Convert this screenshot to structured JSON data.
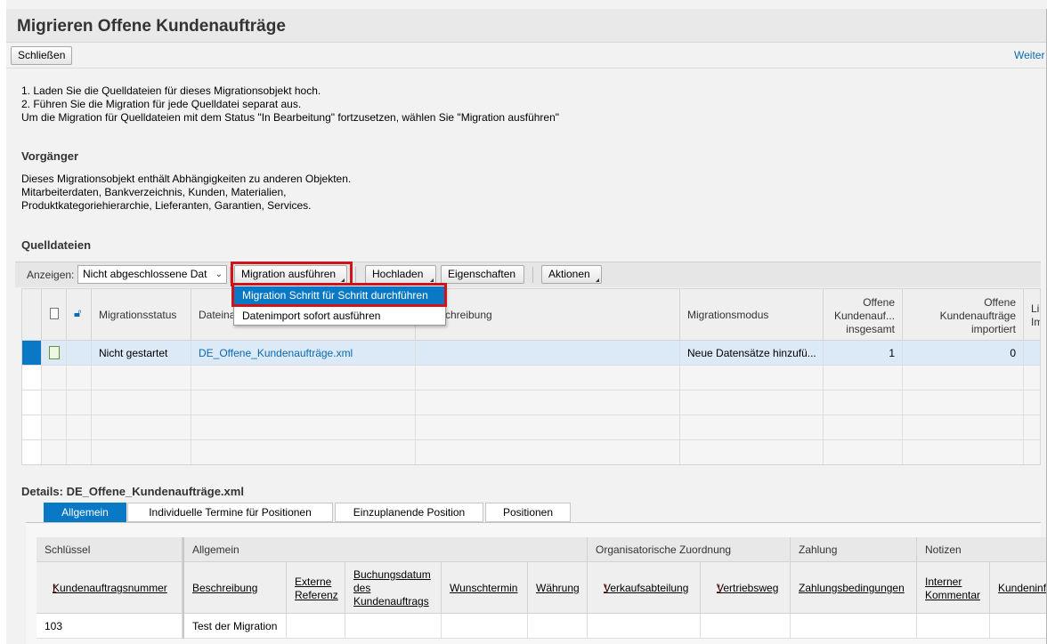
{
  "app": {
    "title": "Migrieren Offene Kundenaufträge",
    "close_label": "Schließen",
    "more_label": "Weiter"
  },
  "intro": {
    "line1": "1. Laden Sie die Quelldateien für dieses Migrationsobjekt hoch.",
    "line2": "2. Führen Sie die Migration für jede Quelldatei separat aus.",
    "line3": "Um die Migration für Quelldateien mit dem Status \"In Bearbeitung\" fortzusetzen, wählen Sie \"Migration ausführen\""
  },
  "predecessors": {
    "heading": "Vorgänger",
    "line1": "Dieses Migrationsobjekt enthält Abhängigkeiten zu anderen Objekten.",
    "line2": "Mitarbeiterdaten, Bankverzeichnis, Kunden, Materialien,",
    "line3": "Produktkategoriehierarchie, Lieferanten, Garantien, Services."
  },
  "source_files": {
    "heading": "Quelldateien",
    "show_label": "Anzeigen:",
    "filter_value": "Nicht abgeschlossene Dat",
    "run_migration": "Migration ausführen",
    "upload": "Hochladen",
    "properties": "Eigenschaften",
    "actions": "Aktionen",
    "menu": {
      "step_by_step": "Migration Schritt für Schritt durchführen",
      "import_now": "Datenimport sofort ausführen"
    },
    "columns": {
      "status": "Migrationsstatus",
      "file_name": "Dateina",
      "description": "schreibung",
      "mode": "Migrationsmodus",
      "total_l1": "Offene",
      "total_l2": "Kundenauf...",
      "total_l3": "insgesamt",
      "imported_l1": "Offene",
      "imported_l2": "Kundenaufträge",
      "imported_l3": "importiert",
      "more_l1": "Lin",
      "more_l2": "Imp"
    },
    "rows": [
      {
        "status": "Nicht gestartet",
        "file_name": "DE_Offene_Kundenaufträge.xml",
        "mode": "Neue Datensätze hinzufü...",
        "total": "1",
        "imported": "0"
      }
    ]
  },
  "details": {
    "heading": "Details: DE_Offene_Kundenaufträge.xml",
    "tabs": [
      "Allgemein",
      "Individuelle Termine für Positionen",
      "Einzuplanende Position",
      "Positionen"
    ],
    "groups": {
      "key": "Schlüssel",
      "general": "Allgemein",
      "org": "Organisatorische Zuordnung",
      "payment": "Zahlung",
      "notes": "Notizen"
    },
    "columns": {
      "order_number": "Kundenauftragsnummer",
      "description": "Beschreibung",
      "ext_ref_l1": "Externe",
      "ext_ref_l2": "Referenz",
      "booking_l1": "Buchungsdatum",
      "booking_l2": "des",
      "booking_l3": "Kundenauftrags",
      "wish_date": "Wunschtermin",
      "currency": "Währung",
      "sales_dept": "Verkaufsabteilung",
      "sales_channel": "Vertriebsweg",
      "payment_terms": "Zahlungsbedingungen",
      "internal_l1": "Interner",
      "internal_l2": "Kommentar",
      "customer_info": "Kundeninf"
    },
    "required_mark": "*",
    "rows": [
      {
        "order_number": "103",
        "description": "Test der Migration"
      }
    ]
  }
}
